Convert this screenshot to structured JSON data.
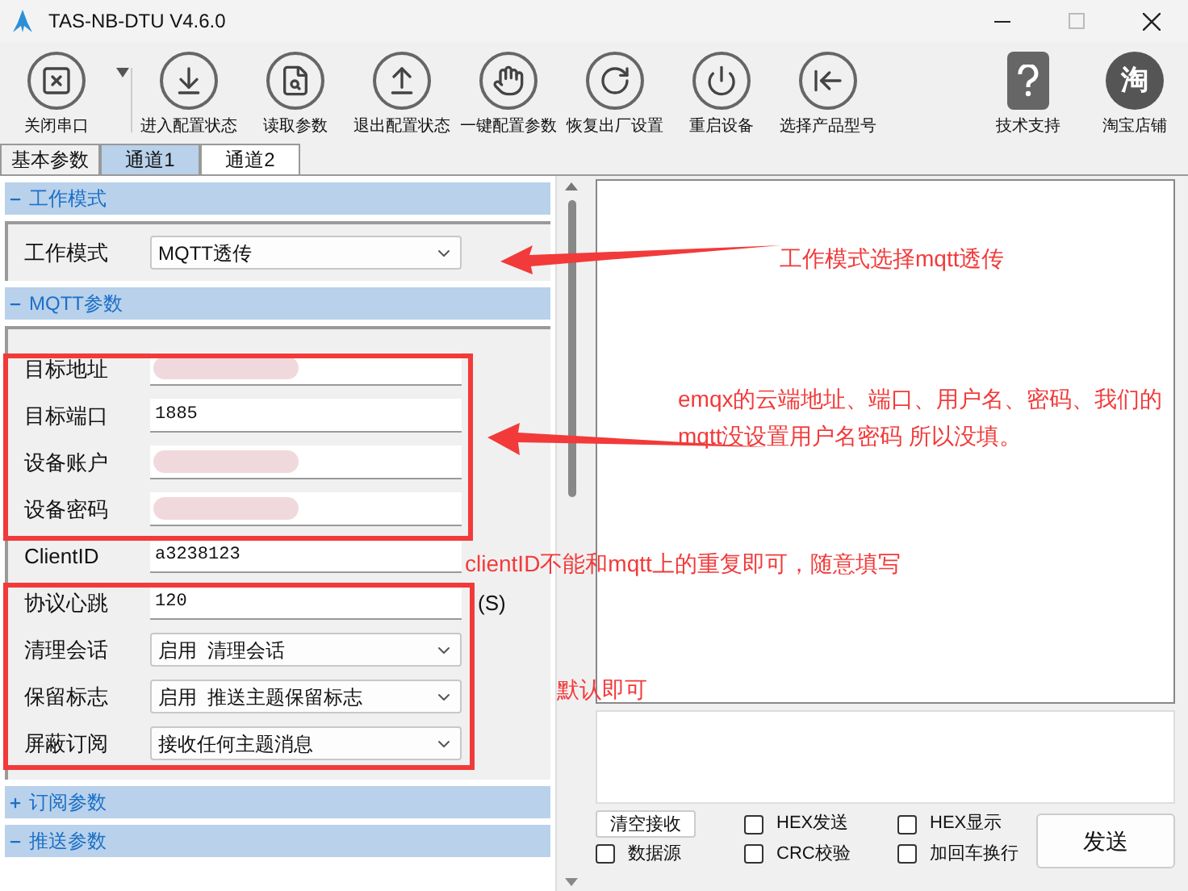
{
  "window": {
    "title": "TAS-NB-DTU V4.6.0"
  },
  "toolbar": [
    {
      "label": "关闭串口",
      "kind": "close"
    },
    {
      "label": "进入配置状态",
      "kind": "enter"
    },
    {
      "label": "读取参数",
      "kind": "read"
    },
    {
      "label": "退出配置状态",
      "kind": "exit"
    },
    {
      "label": "一键配置参数",
      "kind": "hand"
    },
    {
      "label": "恢复出厂设置",
      "kind": "reset"
    },
    {
      "label": "重启设备",
      "kind": "power"
    },
    {
      "label": "选择产品型号",
      "kind": "select"
    },
    {
      "label": "技术支持",
      "kind": "help"
    },
    {
      "label": "淘宝店铺",
      "kind": "shop",
      "glyph": "淘"
    }
  ],
  "tabs": [
    {
      "label": "基本参数",
      "selected": false
    },
    {
      "label": "通道1",
      "selected": true
    },
    {
      "label": "通道2",
      "selected": false
    }
  ],
  "sections": [
    {
      "title": "工作模式",
      "expanded": true,
      "fields": [
        {
          "label": "工作模式",
          "kind": "select",
          "value": "MQTT透传"
        }
      ]
    },
    {
      "title": "MQTT参数",
      "expanded": true,
      "fields": [
        {
          "label": "目标地址",
          "kind": "text",
          "redacted": true
        },
        {
          "label": "目标端口",
          "kind": "text",
          "value": "1885"
        },
        {
          "label": "设备账户",
          "kind": "text",
          "redacted": true
        },
        {
          "label": "设备密码",
          "kind": "text",
          "redacted": true
        },
        {
          "label": "ClientID",
          "kind": "text",
          "value": "a3238123"
        },
        {
          "label": "协议心跳",
          "kind": "text",
          "value": "120",
          "unit": "(S)"
        },
        {
          "label": "清理会话",
          "kind": "select",
          "value": "启用  清理会话"
        },
        {
          "label": "保留标志",
          "kind": "select",
          "value": "启用  推送主题保留标志"
        },
        {
          "label": "屏蔽订阅",
          "kind": "select",
          "value": "接收任何主题消息"
        }
      ]
    },
    {
      "title": "订阅参数",
      "expanded": false
    },
    {
      "title": "推送参数",
      "expanded": true
    }
  ],
  "send_panel": {
    "clear_button": "清空接收",
    "checkboxes": [
      {
        "label": "HEX发送",
        "checked": false
      },
      {
        "label": "HEX显示",
        "checked": false
      },
      {
        "label": "数据源",
        "checked": false
      },
      {
        "label": "CRC校验",
        "checked": false
      },
      {
        "label": "加回车换行",
        "checked": false
      }
    ],
    "send_button": "发送"
  },
  "annotations": [
    "工作模式选择mqtt透传",
    "emqx的云端地址、端口、用户名、密码、我们的mqtt没设置用户名密码 所以没填。",
    "clientID不能和mqtt上的重复即可，随意填写",
    "默认即可"
  ]
}
